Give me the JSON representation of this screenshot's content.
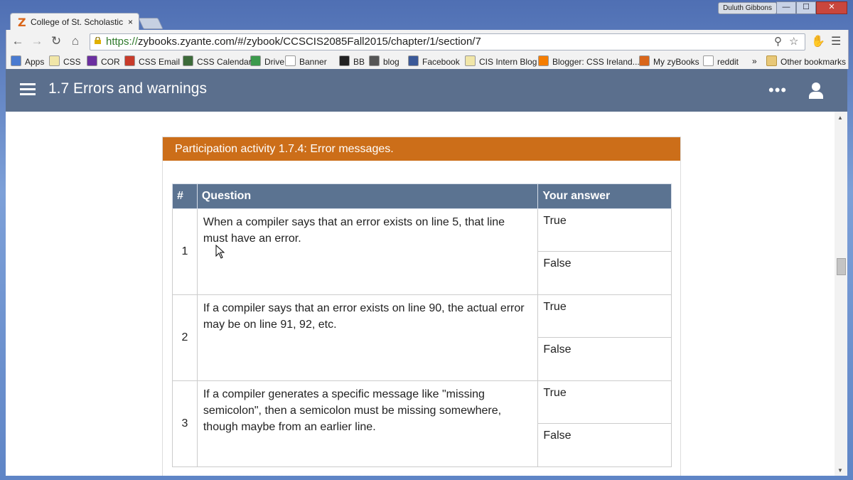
{
  "window": {
    "user": "Duluth Gibbons",
    "buttons": {
      "minimize": "—",
      "maximize": "☐",
      "close": "✕"
    }
  },
  "tab": {
    "title": "College of St. Scholastica",
    "close": "×"
  },
  "address": {
    "scheme": "https://",
    "rest": "zybooks.zyante.com/#/zybook/CCSCIS2085Fall2015/chapter/1/section/7"
  },
  "bookmarks": {
    "items": [
      {
        "label": "Apps",
        "color": "#4a7bd0"
      },
      {
        "label": "CSS",
        "color": "#f1e6a8"
      },
      {
        "label": "COR",
        "color": "#6b2fa0"
      },
      {
        "label": "CSS Email",
        "color": "#c83b2a"
      },
      {
        "label": "CSS Calendar",
        "color": "#3d6b3a"
      },
      {
        "label": "Drive",
        "color": "#3c9a4c"
      },
      {
        "label": "Banner",
        "color": "#ffffff"
      },
      {
        "label": "BB",
        "color": "#222222"
      },
      {
        "label": "blog",
        "color": "#555555"
      },
      {
        "label": "Facebook",
        "color": "#3b5998"
      },
      {
        "label": "CIS Intern Blog",
        "color": "#f1e6a8"
      },
      {
        "label": "Blogger: CSS Ireland...",
        "color": "#f57d00"
      },
      {
        "label": "My zyBooks",
        "color": "#d9661a"
      },
      {
        "label": "reddit",
        "color": "#ffffff"
      }
    ],
    "more": "»",
    "other": "Other bookmarks"
  },
  "app": {
    "title": "1.7 Errors and warnings"
  },
  "activity": {
    "title": "Participation activity 1.7.4: Error messages.",
    "headers": {
      "num": "#",
      "question": "Question",
      "answer": "Your answer"
    },
    "rows": [
      {
        "num": "1",
        "question": "When a compiler says that an error exists on line 5, that line must have an error.",
        "options": [
          "True",
          "False"
        ]
      },
      {
        "num": "2",
        "question": "If a compiler says that an error exists on line 90, the actual error may be on line 91, 92, etc.",
        "options": [
          "True",
          "False"
        ]
      },
      {
        "num": "3",
        "question": "If a compiler generates a specific message like \"missing semicolon\", then a semicolon must be missing somewhere, though maybe from an earlier line.",
        "options": [
          "True",
          "False"
        ]
      }
    ]
  },
  "colors": {
    "accent": "#cc6e19",
    "header": "#5b6f8d",
    "table_header": "#5b7391"
  }
}
